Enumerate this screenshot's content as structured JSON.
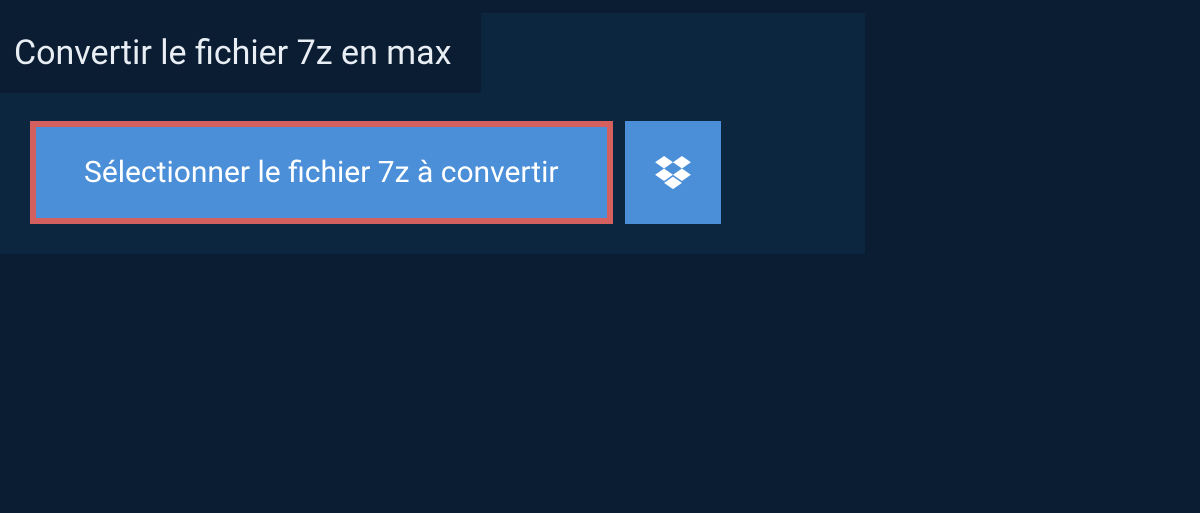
{
  "header": {
    "title": "Convertir le fichier 7z en max"
  },
  "actions": {
    "select_file_label": "Sélectionner le fichier 7z à convertir"
  }
}
